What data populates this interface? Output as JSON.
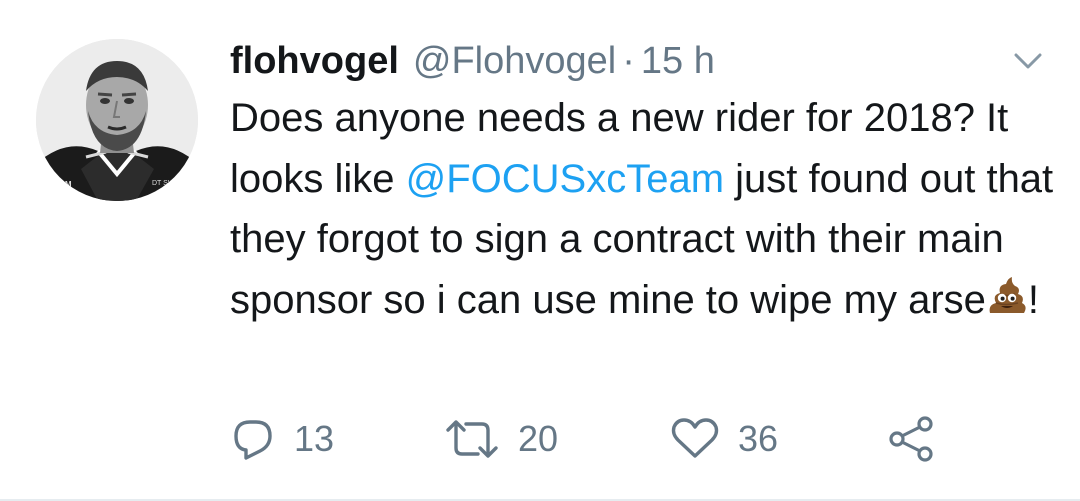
{
  "tweet": {
    "display_name": "flohvogel",
    "handle": "@Flohvogel",
    "separator": "·",
    "time": "15 h",
    "text": {
      "part1": "Does anyone needs a new rider for 2018? It looks like ",
      "mention": "@FOCUSxcTeam",
      "part2": " just found out that they forgot to sign a contract with their main sponsor so i can use mine to wipe my arse",
      "part3": "!"
    },
    "avatar_text": {
      "left": "SRAM",
      "right": "DT SWISS"
    }
  },
  "actions": {
    "reply": {
      "icon": "reply-icon",
      "count": "13"
    },
    "retweet": {
      "icon": "retweet-icon",
      "count": "20"
    },
    "like": {
      "icon": "heart-icon",
      "count": "36"
    },
    "share": {
      "icon": "share-icon"
    }
  },
  "colors": {
    "text": "#14171a",
    "secondary": "#657786",
    "link": "#1da1f2",
    "divider": "#e6ecf0"
  }
}
